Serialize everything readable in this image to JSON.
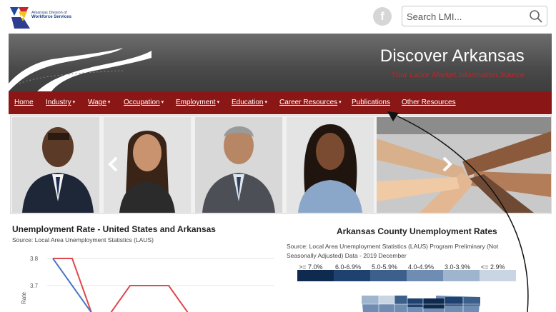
{
  "header": {
    "logo_line1": "Arkansas Division of",
    "logo_line2": "Workforce Services",
    "facebook_glyph": "f",
    "search_placeholder": "Search LMI..."
  },
  "banner": {
    "title": "Discover Arkansas",
    "subtitle": "Your Labor Market Information Source"
  },
  "nav": {
    "items": [
      {
        "label": "Home",
        "dropdown": false
      },
      {
        "label": "Industry",
        "dropdown": true
      },
      {
        "label": "Wage",
        "dropdown": true
      },
      {
        "label": "Occupation",
        "dropdown": true
      },
      {
        "label": "Employment",
        "dropdown": true
      },
      {
        "label": "Education",
        "dropdown": true
      },
      {
        "label": "Career Resources",
        "dropdown": true
      },
      {
        "label": "Publications",
        "dropdown": false
      },
      {
        "label": "Other Resources",
        "dropdown": false
      }
    ],
    "caret": "▾"
  },
  "carousel": {
    "prev_icon": "chevron-left-icon",
    "next_icon": "chevron-right-icon"
  },
  "us_chart": {
    "title": "Unemployment Rate - United States and Arkansas",
    "source": "Source:  Local Area Unemployment Statistics (LAUS)",
    "y_label": "Rate",
    "y_ticks": [
      "3.8",
      "3.7"
    ],
    "chart_data": {
      "type": "line",
      "ylabel": "Rate",
      "series": [
        {
          "values": [
            3.8,
            3.8,
            3.6,
            3.6,
            3.7,
            3.7,
            3.7,
            3.6
          ]
        },
        {
          "values": [
            3.8,
            3.7,
            3.6
          ]
        }
      ]
    }
  },
  "county_map": {
    "title": "Arkansas County Unemployment Rates",
    "source": "Source: Local Area Unemployment Statistics (LAUS) Program Preliminary (Not Seasonally Adjusted) Data - 2019 December",
    "legend": [
      {
        "label": ">= 7.0%",
        "color": "#0e2a4f"
      },
      {
        "label": "6.0-6.9%",
        "color": "#1f4170"
      },
      {
        "label": "5.0-5.9%",
        "color": "#3c5f8c"
      },
      {
        "label": "4.0-4.9%",
        "color": "#6f8db2"
      },
      {
        "label": "3.0-3.9%",
        "color": "#9fb4cd"
      },
      {
        "label": "<= 2.9%",
        "color": "#c9d5e3"
      }
    ]
  },
  "colors": {
    "nav_bg": "#8a1716",
    "subtitle": "#c0252a",
    "series_red": "#e0484b",
    "series_blue": "#4a78c4"
  }
}
